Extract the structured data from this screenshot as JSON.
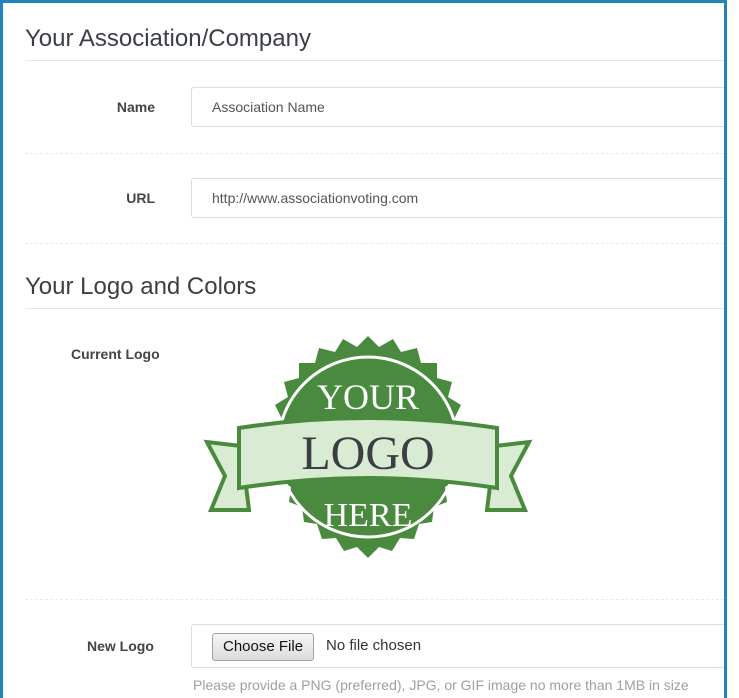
{
  "association": {
    "title": "Your Association/Company",
    "name_label": "Name",
    "name_value": "Association Name",
    "url_label": "URL",
    "url_value": "http://www.associationvoting.com"
  },
  "logo_section": {
    "title": "Your Logo and Colors",
    "current_logo_label": "Current Logo",
    "new_logo_label": "New Logo",
    "choose_file_label": "Choose File",
    "file_status": "No file chosen",
    "help_text": "Please provide a PNG (preferred), JPG, or GIF image no more than 1MB in size",
    "logo_text": {
      "top": "YOUR",
      "middle": "LOGO",
      "bottom": "HERE"
    }
  },
  "colors": {
    "frame": "#1f86b8",
    "logo_green": "#4a8a3f",
    "ribbon": "#d9ecd3"
  }
}
